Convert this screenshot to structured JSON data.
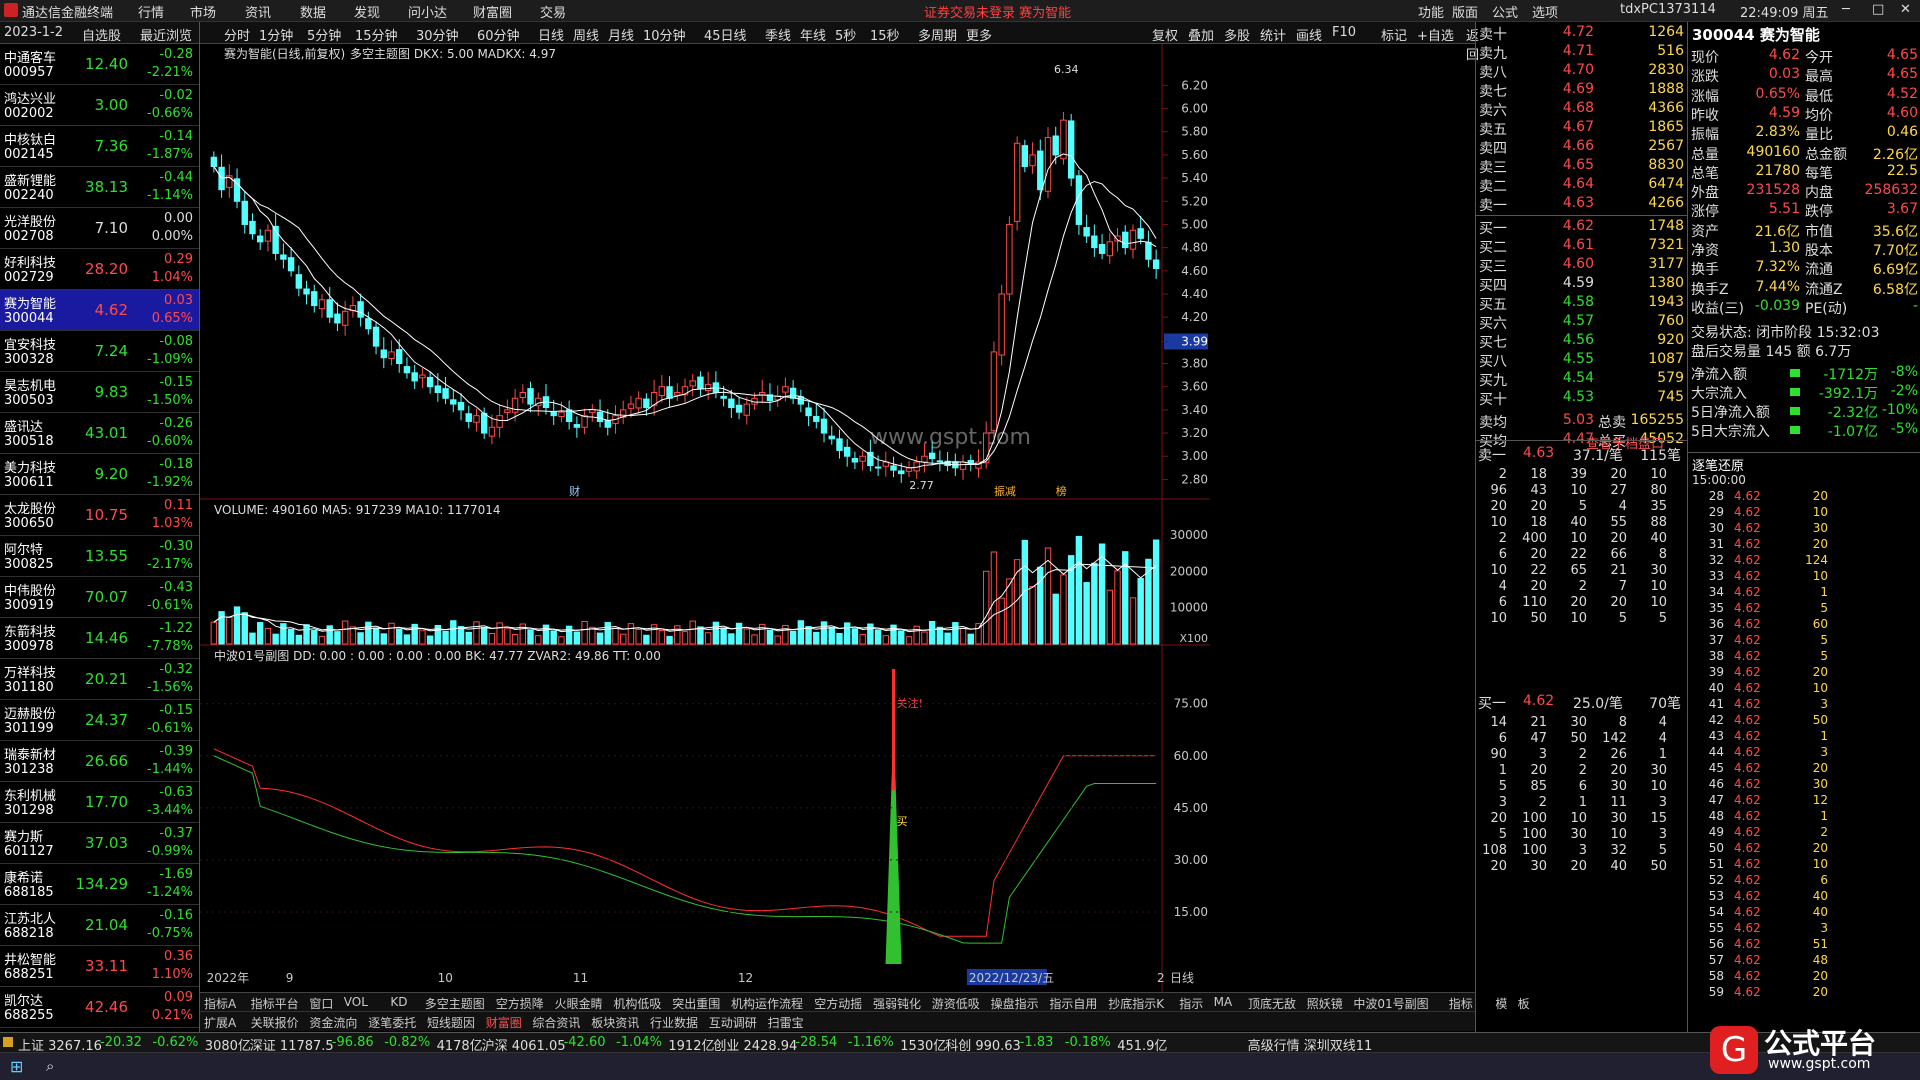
{
  "window": {
    "title": "通达信金融终端",
    "menus": [
      "行情",
      "市场",
      "资讯",
      "数据",
      "发现",
      "问小达",
      "财富圈",
      "交易"
    ],
    "warning": "证券交易未登录  赛为智能",
    "right_items": [
      "功能",
      "版面",
      "公式",
      "选项"
    ],
    "user": "tdxPC1373114",
    "clock": "22:49:09 周五"
  },
  "list": {
    "date": "2023-1-2",
    "tab1": "自选股",
    "tab2": "最近浏览",
    "rows": [
      {
        "name": "中通客车",
        "code": "000957",
        "price": "12.40",
        "chg": "-0.28",
        "pct": "-2.21%",
        "dir": "dn"
      },
      {
        "name": "鸿达兴业",
        "code": "002002",
        "price": "3.00",
        "chg": "-0.02",
        "pct": "-0.66%",
        "dir": "dn"
      },
      {
        "name": "中核钛白",
        "code": "002145",
        "price": "7.36",
        "chg": "-0.14",
        "pct": "-1.87%",
        "dir": "dn"
      },
      {
        "name": "盛新锂能",
        "code": "002240",
        "price": "38.13",
        "chg": "-0.44",
        "pct": "-1.14%",
        "dir": "dn"
      },
      {
        "name": "光洋股份",
        "code": "002708",
        "price": "7.10",
        "chg": "0.00",
        "pct": "0.00%",
        "dir": "fl"
      },
      {
        "name": "好利科技",
        "code": "002729",
        "price": "28.20",
        "chg": "0.29",
        "pct": "1.04%",
        "dir": "up"
      },
      {
        "name": "赛为智能",
        "code": "300044",
        "price": "4.62",
        "chg": "0.03",
        "pct": "0.65%",
        "dir": "up",
        "sel": true
      },
      {
        "name": "宜安科技",
        "code": "300328",
        "price": "7.24",
        "chg": "-0.08",
        "pct": "-1.09%",
        "dir": "dn"
      },
      {
        "name": "昊志机电",
        "code": "300503",
        "price": "9.83",
        "chg": "-0.15",
        "pct": "-1.50%",
        "dir": "dn"
      },
      {
        "name": "盛讯达",
        "code": "300518",
        "price": "43.01",
        "chg": "-0.26",
        "pct": "-0.60%",
        "dir": "dn"
      },
      {
        "name": "美力科技",
        "code": "300611",
        "price": "9.20",
        "chg": "-0.18",
        "pct": "-1.92%",
        "dir": "dn"
      },
      {
        "name": "太龙股份",
        "code": "300650",
        "price": "10.75",
        "chg": "0.11",
        "pct": "1.03%",
        "dir": "up"
      },
      {
        "name": "阿尔特",
        "code": "300825",
        "price": "13.55",
        "chg": "-0.30",
        "pct": "-2.17%",
        "dir": "dn"
      },
      {
        "name": "中伟股份",
        "code": "300919",
        "price": "70.07",
        "chg": "-0.43",
        "pct": "-0.61%",
        "dir": "dn"
      },
      {
        "name": "东箭科技",
        "code": "300978",
        "price": "14.46",
        "chg": "-1.22",
        "pct": "-7.78%",
        "dir": "dn"
      },
      {
        "name": "万祥科技",
        "code": "301180",
        "price": "20.21",
        "chg": "-0.32",
        "pct": "-1.56%",
        "dir": "dn"
      },
      {
        "name": "迈赫股份",
        "code": "301199",
        "price": "24.37",
        "chg": "-0.15",
        "pct": "-0.61%",
        "dir": "dn"
      },
      {
        "name": "瑞泰新材",
        "code": "301238",
        "price": "26.66",
        "chg": "-0.39",
        "pct": "-1.44%",
        "dir": "dn"
      },
      {
        "name": "东利机械",
        "code": "301298",
        "price": "17.70",
        "chg": "-0.63",
        "pct": "-3.44%",
        "dir": "dn"
      },
      {
        "name": "赛力斯",
        "code": "601127",
        "price": "37.03",
        "chg": "-0.37",
        "pct": "-0.99%",
        "dir": "dn"
      },
      {
        "name": "康希诺",
        "code": "688185",
        "price": "134.29",
        "chg": "-1.69",
        "pct": "-1.24%",
        "dir": "dn"
      },
      {
        "name": "江苏北人",
        "code": "688218",
        "price": "21.04",
        "chg": "-0.16",
        "pct": "-0.75%",
        "dir": "dn"
      },
      {
        "name": "井松智能",
        "code": "688251",
        "price": "33.11",
        "chg": "0.36",
        "pct": "1.10%",
        "dir": "up"
      },
      {
        "name": "凯尔达",
        "code": "688255",
        "price": "42.46",
        "chg": "0.09",
        "pct": "0.21%",
        "dir": "up"
      }
    ]
  },
  "chart_toolbar": [
    "分时",
    "1分钟",
    "5分钟",
    "15分钟",
    "30分钟",
    "60分钟",
    "日线",
    "周线",
    "月线",
    "10分钟",
    "45日线",
    "季线",
    "年线",
    "5秒",
    "15秒",
    "多周期",
    "更多"
  ],
  "chart_toolbar_right": [
    "复权",
    "叠加",
    "多股",
    "统计",
    "画线",
    "F10",
    "标记",
    "+自选",
    "返回"
  ],
  "chart": {
    "title": "赛为智能(日线,前复权)",
    "indicator": "多空主题图 DKX: 5.00  MADKX: 4.97",
    "price_axis": [
      "6.20",
      "6.00",
      "5.80",
      "5.60",
      "5.40",
      "5.20",
      "5.00",
      "4.80",
      "4.60",
      "4.40",
      "4.20",
      "3.99",
      "3.80",
      "3.60",
      "3.40",
      "3.20",
      "3.00",
      "2.80"
    ],
    "high_label": "6.34",
    "low_label": "2.77",
    "cross_price": "3.99",
    "watermark": "www.gspt.com",
    "markers": [
      "财",
      "振减",
      "榜"
    ],
    "volume_title": "VOLUME: 490160  MA5: 917239  MA10: 1177014",
    "vol_axis": [
      "30000",
      "20000",
      "10000",
      "X100"
    ],
    "osc_title": "中波01号副图  DD: 0.00  : 0.00  : 0.00  : 0.00  BK: 47.77  ZVAR2: 49.86  TT: 0.00",
    "osc_axis": [
      "75.00",
      "60.00",
      "45.00",
      "30.00",
      "15.00"
    ],
    "osc_label1": "关注!",
    "osc_label2": "买",
    "date_axis": [
      "2022年",
      "9",
      "10",
      "11",
      "12",
      "2022/12/23/五",
      "2",
      "日线"
    ]
  },
  "chart_data": {
    "type": "line",
    "series": [
      {
        "name": "DKX",
        "values": [
          5.0
        ]
      },
      {
        "name": "MADKX",
        "values": [
          4.97
        ]
      }
    ]
  },
  "tabs_row1": [
    "指标A",
    "指标平台",
    "窗口",
    "VOL",
    "KD",
    "多空主题图",
    "空方损降",
    "火眼金睛",
    "机构低吸",
    "突出重围",
    "机构运作流程",
    "空方动摇",
    "强弱钝化",
    "游资低吸",
    "操盘指示",
    "指示自用",
    "抄底指示K",
    "指示",
    "MA",
    "顶底无敌",
    "照妖镜",
    "中波01号副图",
    "指标B",
    "模",
    "板"
  ],
  "tabs_row2": [
    "扩展A",
    "关联报价",
    "资金流向",
    "逐笔委托",
    "短线题因",
    "财富圈",
    "综合资讯",
    "板块资讯",
    "行业数据",
    "互动调研",
    "扫雷宝"
  ],
  "book": {
    "sells": [
      {
        "l": "卖十",
        "p": "4.72",
        "v": "1264"
      },
      {
        "l": "卖九",
        "p": "4.71",
        "v": "516"
      },
      {
        "l": "卖八",
        "p": "4.70",
        "v": "2830"
      },
      {
        "l": "卖七",
        "p": "4.69",
        "v": "1888"
      },
      {
        "l": "卖六",
        "p": "4.68",
        "v": "4366"
      },
      {
        "l": "卖五",
        "p": "4.67",
        "v": "1865"
      },
      {
        "l": "卖四",
        "p": "4.66",
        "v": "2567"
      },
      {
        "l": "卖三",
        "p": "4.65",
        "v": "8830"
      },
      {
        "l": "卖二",
        "p": "4.64",
        "v": "6474"
      },
      {
        "l": "卖一",
        "p": "4.63",
        "v": "4266"
      }
    ],
    "buys": [
      {
        "l": "买一",
        "p": "4.62",
        "v": "1748"
      },
      {
        "l": "买二",
        "p": "4.61",
        "v": "7321"
      },
      {
        "l": "买三",
        "p": "4.60",
        "v": "3177"
      },
      {
        "l": "买四",
        "p": "4.59",
        "v": "1380"
      },
      {
        "l": "买五",
        "p": "4.58",
        "v": "1943"
      },
      {
        "l": "买六",
        "p": "4.57",
        "v": "760"
      },
      {
        "l": "买七",
        "p": "4.56",
        "v": "920"
      },
      {
        "l": "买八",
        "p": "4.55",
        "v": "1087"
      },
      {
        "l": "买九",
        "p": "4.54",
        "v": "579"
      },
      {
        "l": "买十",
        "p": "4.53",
        "v": "745"
      }
    ],
    "avg": [
      {
        "l": "卖均",
        "p": "5.03",
        "c": "总卖",
        "v": "165255"
      },
      {
        "l": "买均",
        "p": "4.47",
        "c": "总买",
        "v": "45052"
      }
    ],
    "link": "查看千档盘口",
    "queue_sell": {
      "label": "卖一",
      "price": "4.63",
      "avg": "37.1/笔",
      "count": "115笔"
    },
    "queue_buy": {
      "label": "买一",
      "price": "4.62",
      "avg": "25.0/笔",
      "count": "70笔"
    }
  },
  "quote": {
    "title": "300044 赛为智能",
    "rows": [
      [
        "现价",
        "4.62",
        "今开",
        "4.65"
      ],
      [
        "涨跌",
        "0.03",
        "最高",
        "4.65"
      ],
      [
        "涨幅",
        "0.65%",
        "最低",
        "4.52"
      ],
      [
        "昨收",
        "4.59",
        "均价",
        "4.60"
      ],
      [
        "振幅",
        "2.83%",
        "量比",
        "0.46"
      ],
      [
        "总量",
        "490160",
        "总金额",
        "2.26亿"
      ],
      [
        "总笔",
        "21780",
        "每笔",
        "22.5"
      ],
      [
        "外盘",
        "231528",
        "内盘",
        "258632"
      ],
      [
        "涨停",
        "5.51",
        "跌停",
        "3.67"
      ],
      [
        "资产",
        "21.6亿",
        "市值",
        "35.6亿"
      ],
      [
        "净资",
        "1.30",
        "股本",
        "7.70亿"
      ],
      [
        "换手",
        "7.32%",
        "流通",
        "6.69亿"
      ],
      [
        "换手Z",
        "7.44%",
        "流通Z",
        "6.58亿"
      ],
      [
        "收益(三)",
        "-0.039",
        "PE(动)",
        "-"
      ]
    ],
    "state": "交易状态: 闭市阶段 15:32:03",
    "after": "盘后交易量 145 额 6.7万",
    "flows": [
      [
        "净流入额",
        "-1712万",
        "-8%"
      ],
      [
        "大宗流入",
        "-392.1万",
        "-2%"
      ],
      [
        "5日净流入额",
        "-2.32亿",
        "-10%"
      ],
      [
        "5日大宗流入",
        "-1.07亿",
        "-5%"
      ]
    ],
    "ticks_title": "逐笔还原",
    "tick_time": "15:00:00"
  },
  "status": {
    "items": [
      {
        "t": "上证 3267.16",
        "c": "fl"
      },
      {
        "t": "-20.32",
        "c": "dn"
      },
      {
        "t": "-0.62%",
        "c": "dn"
      },
      {
        "t": "3080亿",
        "c": "fl"
      },
      {
        "t": "深证 11787.5",
        "c": "fl"
      },
      {
        "t": "-96.86",
        "c": "dn"
      },
      {
        "t": "-0.82%",
        "c": "dn"
      },
      {
        "t": "4178亿",
        "c": "fl"
      },
      {
        "t": "沪深 4061.05",
        "c": "fl"
      },
      {
        "t": "-42.60",
        "c": "dn"
      },
      {
        "t": "-1.04%",
        "c": "dn"
      },
      {
        "t": "1912亿",
        "c": "fl"
      },
      {
        "t": "创业 2428.94",
        "c": "fl"
      },
      {
        "t": "-28.54",
        "c": "dn"
      },
      {
        "t": "-1.16%",
        "c": "dn"
      },
      {
        "t": "1530亿",
        "c": "fl"
      },
      {
        "t": "科创 990.63",
        "c": "fl"
      },
      {
        "t": "-1.83",
        "c": "dn"
      },
      {
        "t": "-0.18%",
        "c": "dn"
      },
      {
        "t": "451.9亿",
        "c": "fl"
      },
      {
        "t": "高级行情 深圳双线11",
        "c": "fl"
      }
    ]
  },
  "watermark_logo": {
    "text": "公式平台",
    "url": "www.gspt.com"
  },
  "colors": {
    "up": "#ff4a4a",
    "down": "#30e030",
    "candle_down": "#54ffff",
    "ma": "#ffffff",
    "osc_red": "#ff3030",
    "osc_green": "#30c030",
    "selected": "#1a1aa0"
  }
}
